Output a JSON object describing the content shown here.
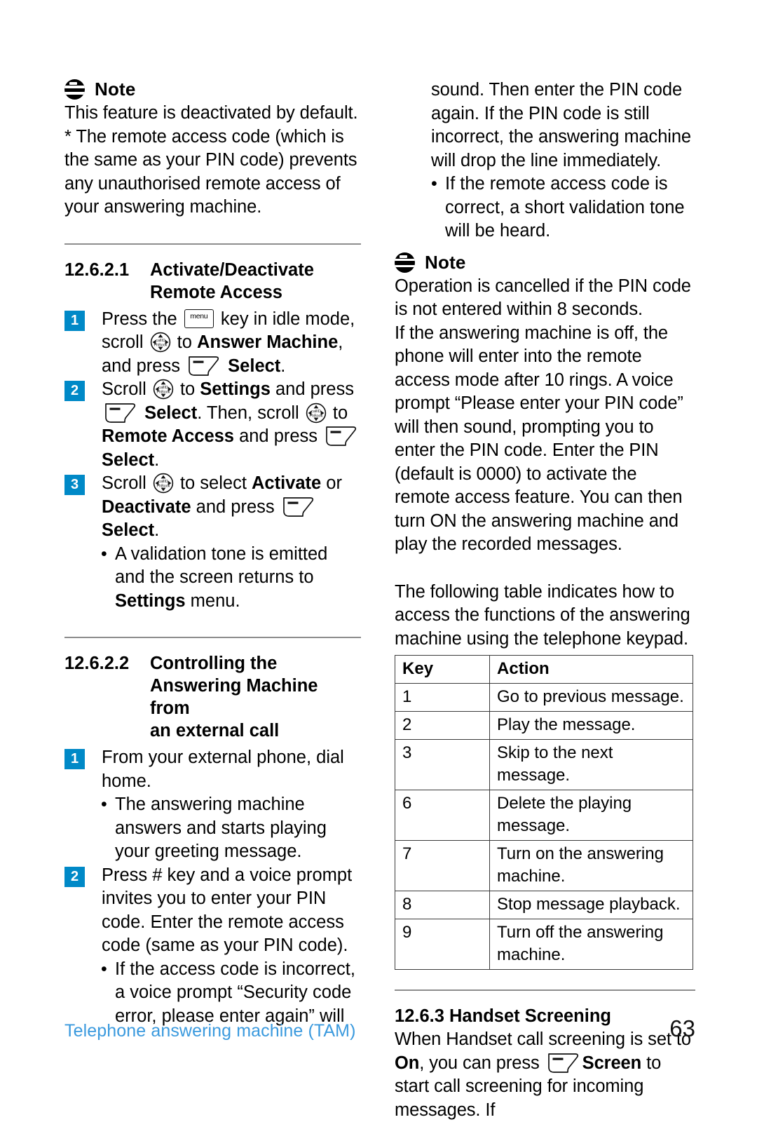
{
  "document": {
    "footer_title": "Telephone answering machine (TAM)",
    "page_number": "63",
    "accent_color": "#0089c7",
    "footer_color": "#3b9ade"
  },
  "icons": {
    "menu_key_label": "menu",
    "scroll_key_top_label": "callID",
    "scroll_key_bottom_label": "PhBook",
    "note_icon": "note-circle-icon",
    "soft_key": "soft-key-icon"
  },
  "left_column": {
    "note": {
      "title": "Note",
      "lines": [
        "This feature is deactivated by default.",
        "* The remote access code (which is the same as your PIN code) prevents any unauthorised remote access of your answering machine."
      ]
    },
    "section_1": {
      "number": "12.6.2.1",
      "title_line_1": "Activate/Deactivate",
      "title_line_2": "Remote Access",
      "steps": [
        {
          "badge": "1",
          "parts": [
            {
              "type": "text",
              "value": "Press the "
            },
            {
              "type": "icon",
              "value": "menu-key-icon"
            },
            {
              "type": "text",
              "value": " key in idle mode, scroll "
            },
            {
              "type": "icon",
              "value": "scroll-key-icon"
            },
            {
              "type": "text",
              "value": " to "
            },
            {
              "type": "bold",
              "value": "Answer Machine"
            },
            {
              "type": "text",
              "value": ", and press "
            },
            {
              "type": "icon",
              "value": "soft-key-icon"
            },
            {
              "type": "bold",
              "value": " Select"
            },
            {
              "type": "text",
              "value": "."
            }
          ]
        },
        {
          "badge": "2",
          "parts": [
            {
              "type": "text",
              "value": "Scroll "
            },
            {
              "type": "icon",
              "value": "scroll-key-icon"
            },
            {
              "type": "text",
              "value": " to "
            },
            {
              "type": "bold",
              "value": "Settings"
            },
            {
              "type": "text",
              "value": " and press "
            },
            {
              "type": "icon",
              "value": "soft-key-icon"
            },
            {
              "type": "bold",
              "value": " Select"
            },
            {
              "type": "text",
              "value": ". Then, scroll "
            },
            {
              "type": "icon",
              "value": "scroll-key-icon"
            },
            {
              "type": "text",
              "value": " to "
            },
            {
              "type": "bold",
              "value": "Remote Access"
            },
            {
              "type": "text",
              "value": " and press "
            },
            {
              "type": "icon",
              "value": "soft-key-icon"
            },
            {
              "type": "bold",
              "value": " Select"
            },
            {
              "type": "text",
              "value": "."
            }
          ]
        },
        {
          "badge": "3",
          "parts": [
            {
              "type": "text",
              "value": "Scroll "
            },
            {
              "type": "icon",
              "value": "scroll-key-icon"
            },
            {
              "type": "text",
              "value": " to select "
            },
            {
              "type": "bold",
              "value": "Activate"
            },
            {
              "type": "text",
              "value": " or "
            },
            {
              "type": "bold",
              "value": "Deactivate"
            },
            {
              "type": "text",
              "value": " and press "
            },
            {
              "type": "icon",
              "value": "soft-key-icon"
            },
            {
              "type": "bold",
              "value": " Select"
            },
            {
              "type": "text",
              "value": "."
            }
          ]
        }
      ],
      "bullet_1_pre": "A validation tone is emitted and the screen returns to ",
      "bullet_1_bold": "Settings",
      "bullet_1_post": " menu."
    },
    "section_2": {
      "number": "12.6.2.2",
      "title_line_1": "Controlling the",
      "title_line_2": "Answering Machine from",
      "title_line_3": "an external call",
      "step_1_badge": "1",
      "step_1_text": "From your external phone, dial home.",
      "bullet_1": "The answering machine answers and starts playing your greeting message.",
      "step_2_badge": "2",
      "step_2_text": "Press # key and a voice prompt invites you to enter your PIN code. Enter the remote access code (same as your PIN code).",
      "bullet_2": "If the access code is incorrect, a voice prompt “Security code error, please enter again” will"
    }
  },
  "right_column": {
    "continued_text": "sound. Then enter the PIN code again. If the PIN code is still incorrect, the answering machine will drop the line immediately.",
    "continued_bullet": "If the remote access code is correct, a short validation tone will be heard.",
    "note": {
      "title": "Note",
      "lines": [
        "Operation is cancelled if the PIN code is not entered within 8 seconds.",
        "If the answering machine is off, the phone will enter into the remote access mode after 10 rings. A voice prompt “Please enter your PIN code” will then sound, prompting you to enter the PIN code. Enter the PIN (default is 0000) to activate the remote access feature. You can then turn ON the answering machine and play the recorded messages."
      ]
    },
    "table_intro": "The following table indicates how to access the functions of the answering machine using the telephone keypad.",
    "table": {
      "headers": [
        "Key",
        "Action"
      ],
      "rows": [
        [
          "1",
          "Go to previous message."
        ],
        [
          "2",
          "Play the message."
        ],
        [
          "3",
          "Skip to the next message."
        ],
        [
          "6",
          "Delete the playing message."
        ],
        [
          "7",
          "Turn on the answering machine."
        ],
        [
          "8",
          "Stop message playback."
        ],
        [
          "9",
          "Turn off the answering machine."
        ]
      ]
    },
    "section_3": {
      "number": "12.6.3",
      "title": "Handset Screening",
      "text_pre": "When Handset call screening is set to ",
      "text_bold_on": "On",
      "text_mid": ", you can press ",
      "text_bold_screen": "Screen",
      "text_post": " to start call screening for incoming messages. If"
    }
  }
}
